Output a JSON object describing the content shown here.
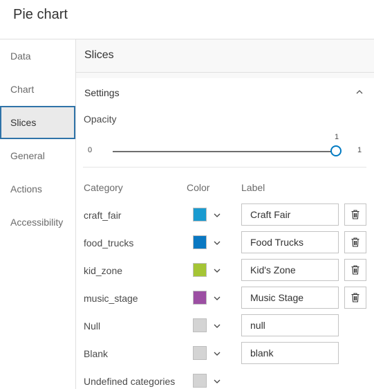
{
  "header": {
    "title": "Pie chart"
  },
  "sidebar": {
    "items": [
      {
        "label": "Data"
      },
      {
        "label": "Chart"
      },
      {
        "label": "Slices"
      },
      {
        "label": "General"
      },
      {
        "label": "Actions"
      },
      {
        "label": "Accessibility"
      }
    ]
  },
  "main": {
    "section_title": "Slices",
    "settings": {
      "title": "Settings",
      "opacity": {
        "label": "Opacity",
        "min": "0",
        "max": "1",
        "value": "1"
      },
      "columns": {
        "category": "Category",
        "color": "Color",
        "label": "Label"
      },
      "rows": [
        {
          "category": "craft_fair",
          "color": "#1a9bd0",
          "label": "Craft Fair"
        },
        {
          "category": "food_trucks",
          "color": "#0a78c2",
          "label": "Food Trucks"
        },
        {
          "category": "kid_zone",
          "color": "#a5c535",
          "label": "Kid's Zone"
        },
        {
          "category": "music_stage",
          "color": "#9c4fa3",
          "label": "Music Stage"
        },
        {
          "category": "Null",
          "color": "#d4d4d4",
          "label": "null"
        },
        {
          "category": "Blank",
          "color": "#d4d4d4",
          "label": "blank"
        },
        {
          "category": "Undefined categories",
          "color": "#d4d4d4"
        }
      ]
    }
  }
}
